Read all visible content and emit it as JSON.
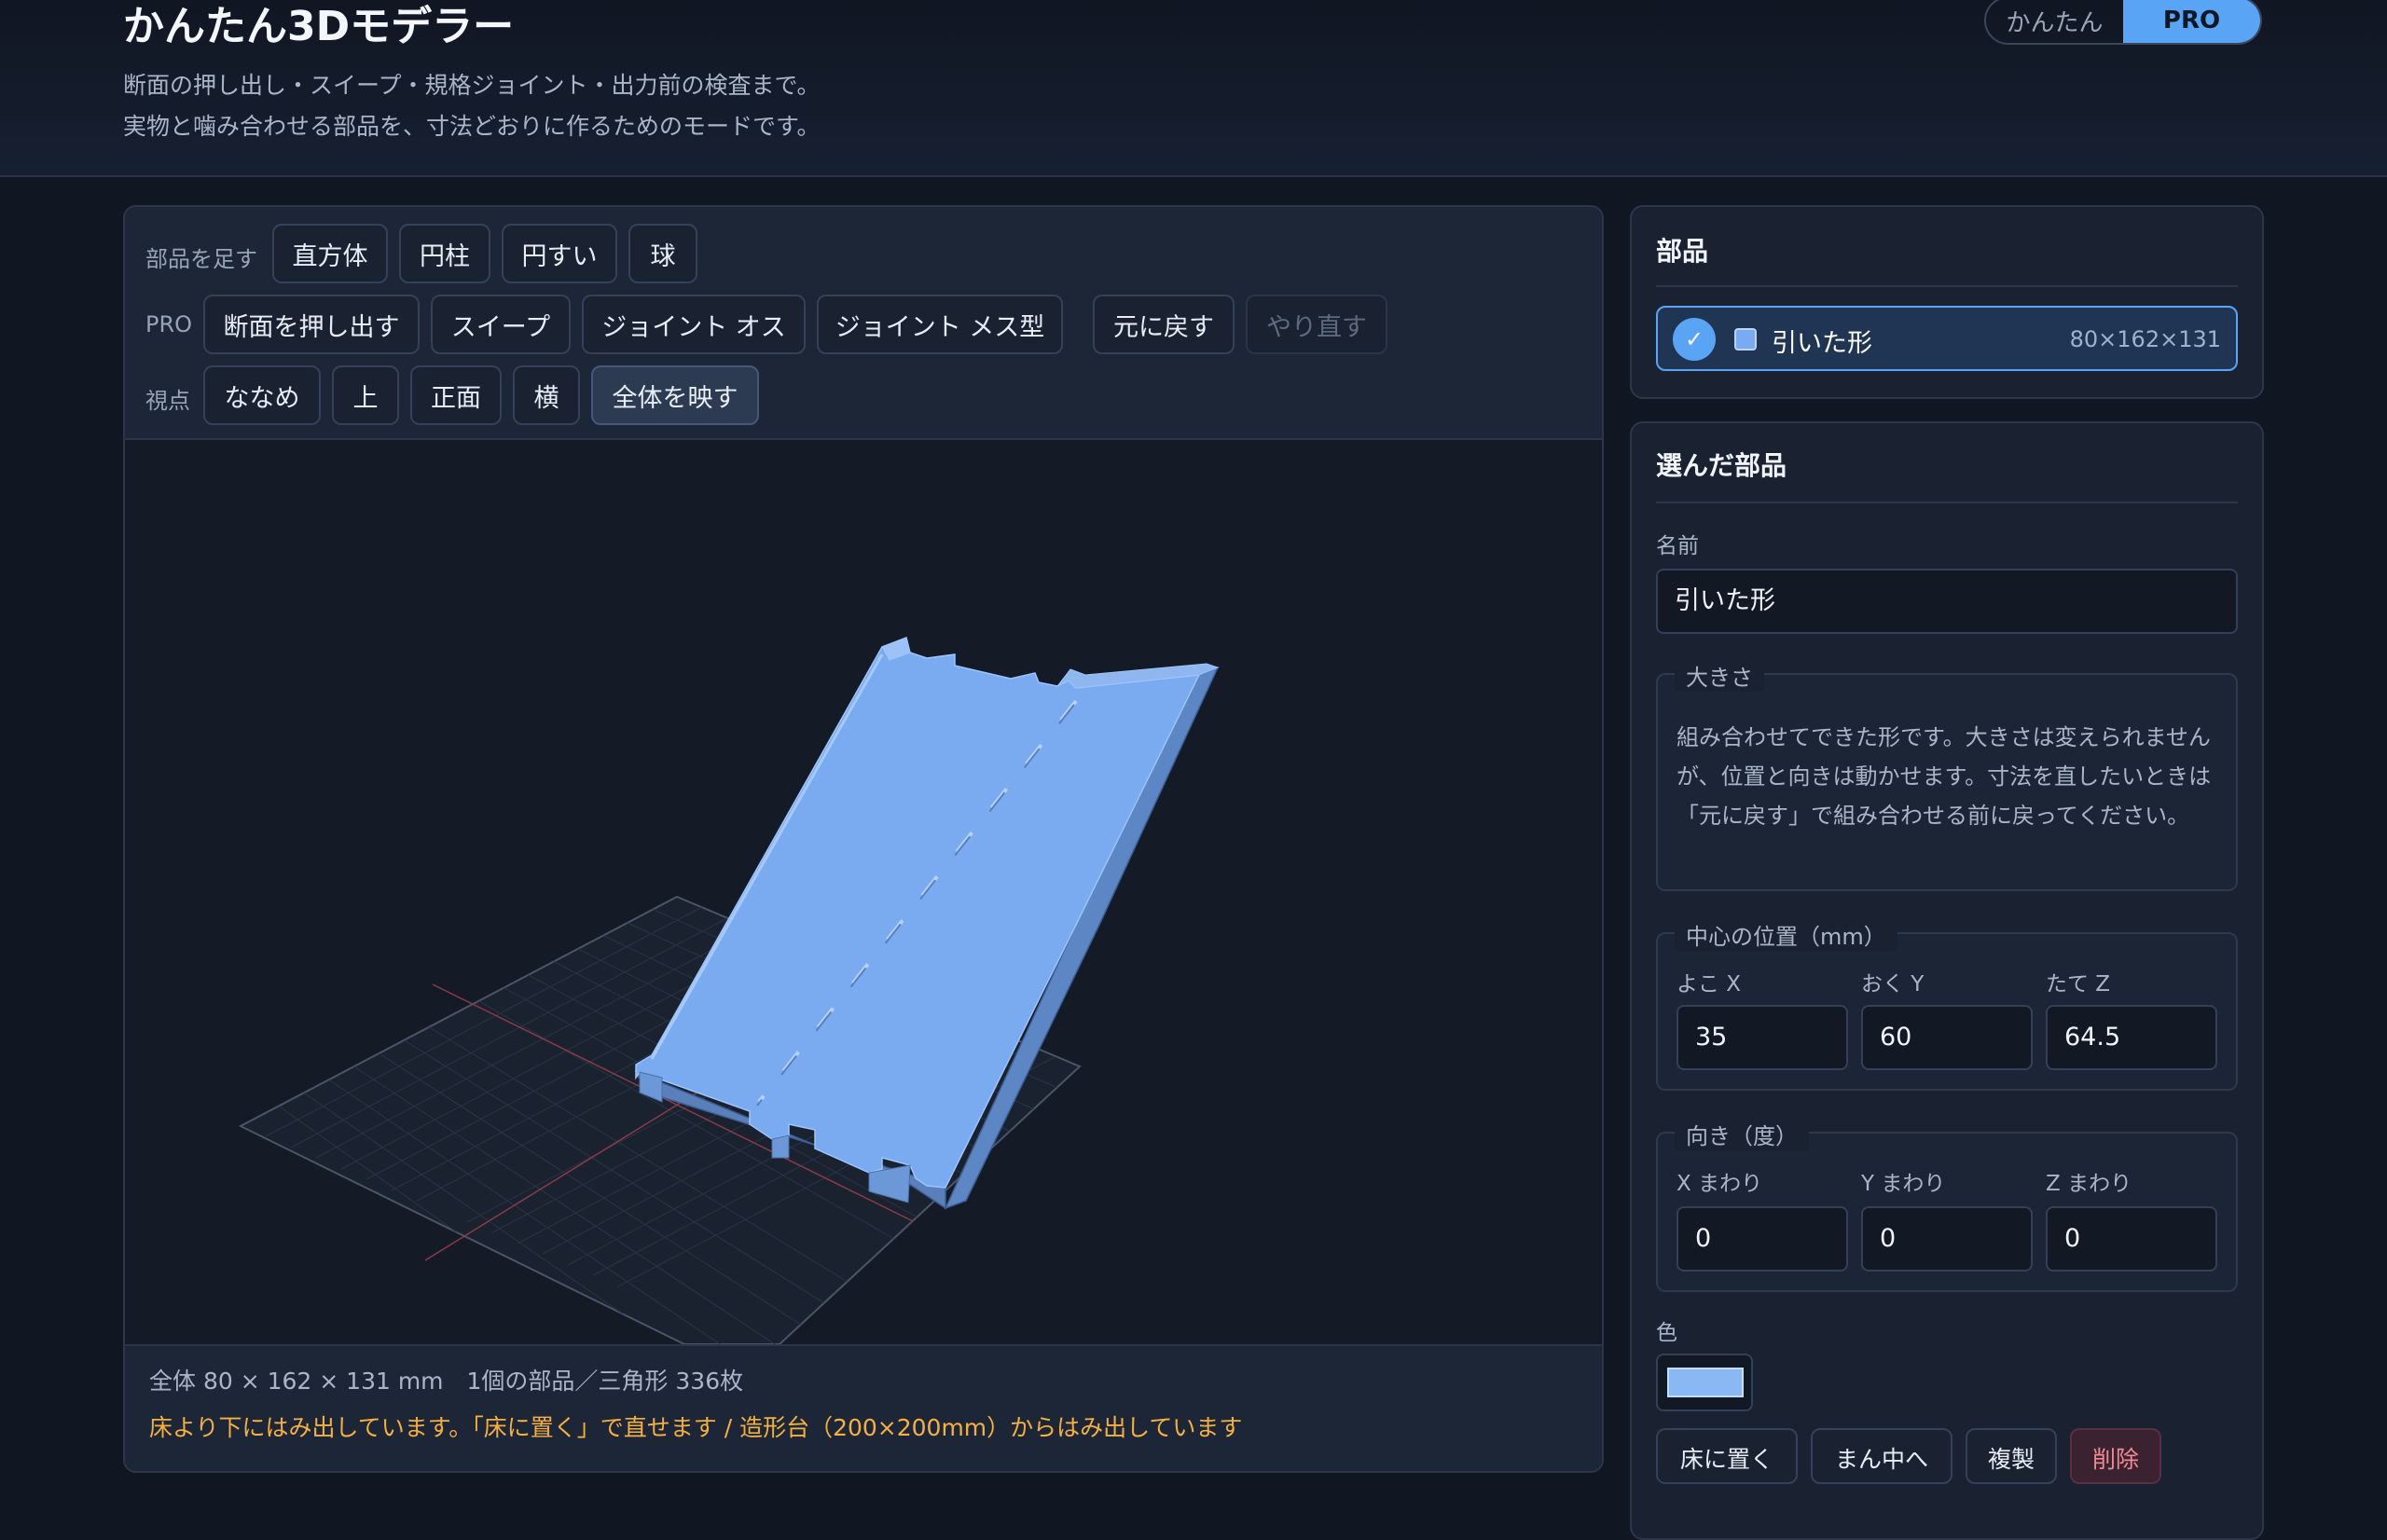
{
  "header": {
    "title": "かんたん3Dモデラー",
    "desc_line1": "断面の押し出し・スイープ・規格ジョイント・出力前の検査まで。",
    "desc_line2": "実物と噛み合わせる部品を、寸法どおりに作るためのモードです。",
    "mode_easy": "かんたん",
    "mode_pro": "PRO"
  },
  "toolbar": {
    "add_label": "部品を足す",
    "add_buttons": [
      "直方体",
      "円柱",
      "円すい",
      "球"
    ],
    "pro_label": "PRO",
    "pro_buttons": [
      "断面を押し出す",
      "スイープ",
      "ジョイント オス",
      "ジョイント メス型"
    ],
    "undo": "元に戻す",
    "redo": "やり直す",
    "view_label": "視点",
    "view_buttons": [
      "ななめ",
      "上",
      "正面",
      "横"
    ],
    "fit_all": "全体を映す"
  },
  "status": {
    "dims": "全体 80 × 162 × 131 mm　1個の部品／三角形 336枚",
    "warning": "床より下にはみ出しています。「床に置く」で直せます / 造形台（200×200mm）からはみ出しています"
  },
  "parts_panel": {
    "title": "部品",
    "items": [
      {
        "name": "引いた形",
        "size": "80×162×131",
        "checkmark": "✓",
        "color": "#7aaaf0"
      }
    ]
  },
  "selected_panel": {
    "title": "選んだ部品",
    "name_label": "名前",
    "name_value": "引いた形",
    "size_legend": "大きさ",
    "size_info": "組み合わせてできた形です。大きさは変えられませんが、位置と向きは動かせます。寸法を直したいときは「元に戻す」で組み合わせる前に戻ってください。",
    "position_legend": "中心の位置（mm）",
    "position_labels": [
      "よこ X",
      "おく Y",
      "たて Z"
    ],
    "position_values": [
      "35",
      "60",
      "64.5"
    ],
    "rotation_legend": "向き（度）",
    "rotation_labels": [
      "X まわり",
      "Y まわり",
      "Z まわり"
    ],
    "rotation_values": [
      "0",
      "0",
      "0"
    ],
    "color_label": "色",
    "color_value": "#8ab8f5",
    "action_buttons": [
      "床に置く",
      "まん中へ",
      "複製",
      "削除"
    ]
  },
  "colors": {
    "accent": "#5aa4f6",
    "model": "#7aaaf0",
    "warning": "#f5b041"
  }
}
